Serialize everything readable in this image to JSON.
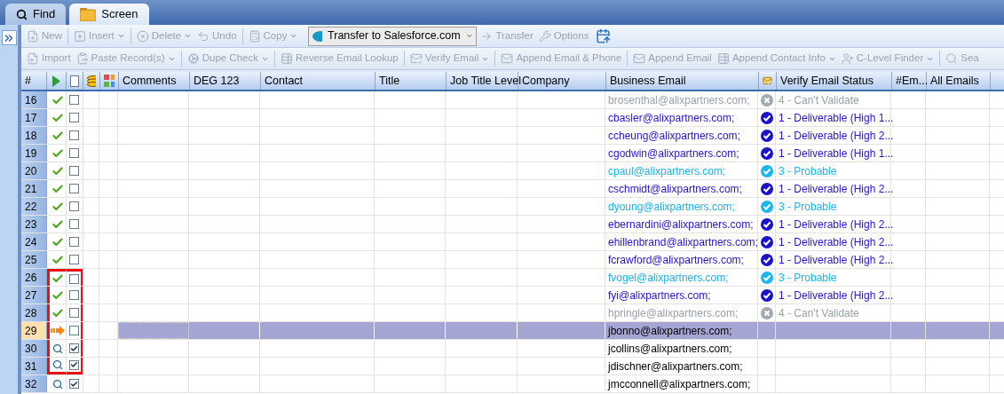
{
  "tabs": [
    {
      "label": "Find",
      "kind": "search",
      "selected": false
    },
    {
      "label": "Screen",
      "kind": "folder",
      "selected": true
    }
  ],
  "toolbar_1": [
    {
      "label": "New",
      "disabled": true,
      "menu": false
    },
    {
      "label": "Insert",
      "disabled": true,
      "menu": true
    },
    {
      "label": "Delete",
      "disabled": true,
      "menu": true
    },
    {
      "label": "Undo",
      "disabled": true,
      "menu": false
    },
    {
      "label": "Copy",
      "disabled": true,
      "menu": true
    }
  ],
  "transfer_select": {
    "value": "Transfer to Salesforce.com"
  },
  "toolbar_1b": [
    {
      "label": "Transfer",
      "disabled": true,
      "menu": false
    },
    {
      "label": "Options",
      "disabled": true,
      "menu": false
    }
  ],
  "toolbar_2": [
    {
      "label": "Import",
      "disabled": true,
      "menu": false
    },
    {
      "label": "Paste Record(s)",
      "disabled": true,
      "menu": true
    },
    {
      "label": "Dupe Check",
      "disabled": true,
      "menu": true
    },
    {
      "label": "Reverse Email Lookup",
      "disabled": true,
      "menu": false
    },
    {
      "label": "Verify Email",
      "disabled": true,
      "menu": true
    },
    {
      "label": "Append Email & Phone",
      "disabled": true,
      "menu": false
    },
    {
      "label": "Append Email",
      "disabled": true,
      "menu": false
    },
    {
      "label": "Append Contact Info",
      "disabled": true,
      "menu": true
    },
    {
      "label": "C-Level Finder",
      "disabled": true,
      "menu": true
    },
    {
      "label": "Sea",
      "disabled": true,
      "menu": false
    }
  ],
  "columns": [
    {
      "kind": "text",
      "label": "#"
    },
    {
      "kind": "play"
    },
    {
      "kind": "checkbox",
      "checked": false
    },
    {
      "kind": "coins"
    },
    {
      "kind": "grid"
    },
    {
      "kind": "text",
      "label": "Comments"
    },
    {
      "kind": "text",
      "label": "DEG 123"
    },
    {
      "kind": "text",
      "label": "Contact"
    },
    {
      "kind": "text",
      "label": "Title"
    },
    {
      "kind": "text",
      "label": "Job Title Level"
    },
    {
      "kind": "text",
      "label": "Company"
    },
    {
      "kind": "text",
      "label": "Business Email"
    },
    {
      "kind": "mail"
    },
    {
      "kind": "text",
      "label": "Verify Email Status"
    },
    {
      "kind": "text",
      "label": "#Em..."
    },
    {
      "kind": "text",
      "label": "All Emails"
    }
  ],
  "rows": [
    {
      "num": "16",
      "kind": "done",
      "checked": false,
      "selected": false,
      "highlighted": false,
      "email": "brosenthal@alixpartners.com;",
      "verification": {
        "kind": "cant_validate",
        "status": "4 - Can't Validate"
      }
    },
    {
      "num": "17",
      "kind": "done",
      "checked": false,
      "selected": false,
      "highlighted": false,
      "email": "cbasler@alixpartners.com;",
      "verification": {
        "kind": "deliverable",
        "status": "1 - Deliverable (High 1..."
      }
    },
    {
      "num": "18",
      "kind": "done",
      "checked": false,
      "selected": false,
      "highlighted": false,
      "email": "ccheung@alixpartners.com;",
      "verification": {
        "kind": "deliverable",
        "status": "1 - Deliverable (High 2..."
      }
    },
    {
      "num": "19",
      "kind": "done",
      "checked": false,
      "selected": false,
      "highlighted": false,
      "email": "cgodwin@alixpartners.com;",
      "verification": {
        "kind": "deliverable",
        "status": "1 - Deliverable (High 1..."
      }
    },
    {
      "num": "20",
      "kind": "done",
      "checked": false,
      "selected": false,
      "highlighted": false,
      "email": "cpaul@alixpartners.com;",
      "verification": {
        "kind": "probable",
        "status": "3 - Probable"
      }
    },
    {
      "num": "21",
      "kind": "done",
      "checked": false,
      "selected": false,
      "highlighted": false,
      "email": "cschmidt@alixpartners.com;",
      "verification": {
        "kind": "deliverable",
        "status": "1 - Deliverable (High 2..."
      }
    },
    {
      "num": "22",
      "kind": "done",
      "checked": false,
      "selected": false,
      "highlighted": false,
      "email": "dyoung@alixpartners.com;",
      "verification": {
        "kind": "probable",
        "status": "3 - Probable"
      }
    },
    {
      "num": "23",
      "kind": "done",
      "checked": false,
      "selected": false,
      "highlighted": false,
      "email": "ebernardini@alixpartners.com;",
      "verification": {
        "kind": "deliverable",
        "status": "1 - Deliverable (High 2..."
      }
    },
    {
      "num": "24",
      "kind": "done",
      "checked": false,
      "selected": false,
      "highlighted": false,
      "email": "ehillenbrand@alixpartners.com;",
      "verification": {
        "kind": "deliverable",
        "status": "1 - Deliverable (High 2..."
      }
    },
    {
      "num": "25",
      "kind": "done",
      "checked": false,
      "selected": false,
      "highlighted": false,
      "email": "fcrawford@alixpartners.com;",
      "verification": {
        "kind": "deliverable",
        "status": "1 - Deliverable (High 2..."
      }
    },
    {
      "num": "26",
      "kind": "done",
      "checked": false,
      "selected": false,
      "highlighted": true,
      "email": "fvogel@alixpartners.com;",
      "verification": {
        "kind": "probable",
        "status": "3 - Probable"
      }
    },
    {
      "num": "27",
      "kind": "done",
      "checked": false,
      "selected": false,
      "highlighted": true,
      "email": "fyi@alixpartners.com;",
      "verification": {
        "kind": "deliverable",
        "status": "1 - Deliverable (High 2..."
      }
    },
    {
      "num": "28",
      "kind": "done",
      "checked": false,
      "selected": false,
      "highlighted": true,
      "email": "hpringle@alixpartners.com;",
      "verification": {
        "kind": "cant_validate",
        "status": "4 - Can't Validate"
      }
    },
    {
      "num": "29",
      "kind": "current",
      "checked": false,
      "selected": true,
      "highlighted": true,
      "email": "jbonno@alixpartners.com;"
    },
    {
      "num": "30",
      "kind": "search",
      "checked": true,
      "selected": false,
      "highlighted": true,
      "email": "jcollins@alixpartners.com;"
    },
    {
      "num": "31",
      "kind": "search",
      "checked": true,
      "selected": false,
      "highlighted": true,
      "email": "jdischner@alixpartners.com;"
    },
    {
      "num": "32",
      "kind": "search",
      "checked": true,
      "selected": false,
      "highlighted": false,
      "email": "jmcconnell@alixpartners.com;"
    }
  ]
}
